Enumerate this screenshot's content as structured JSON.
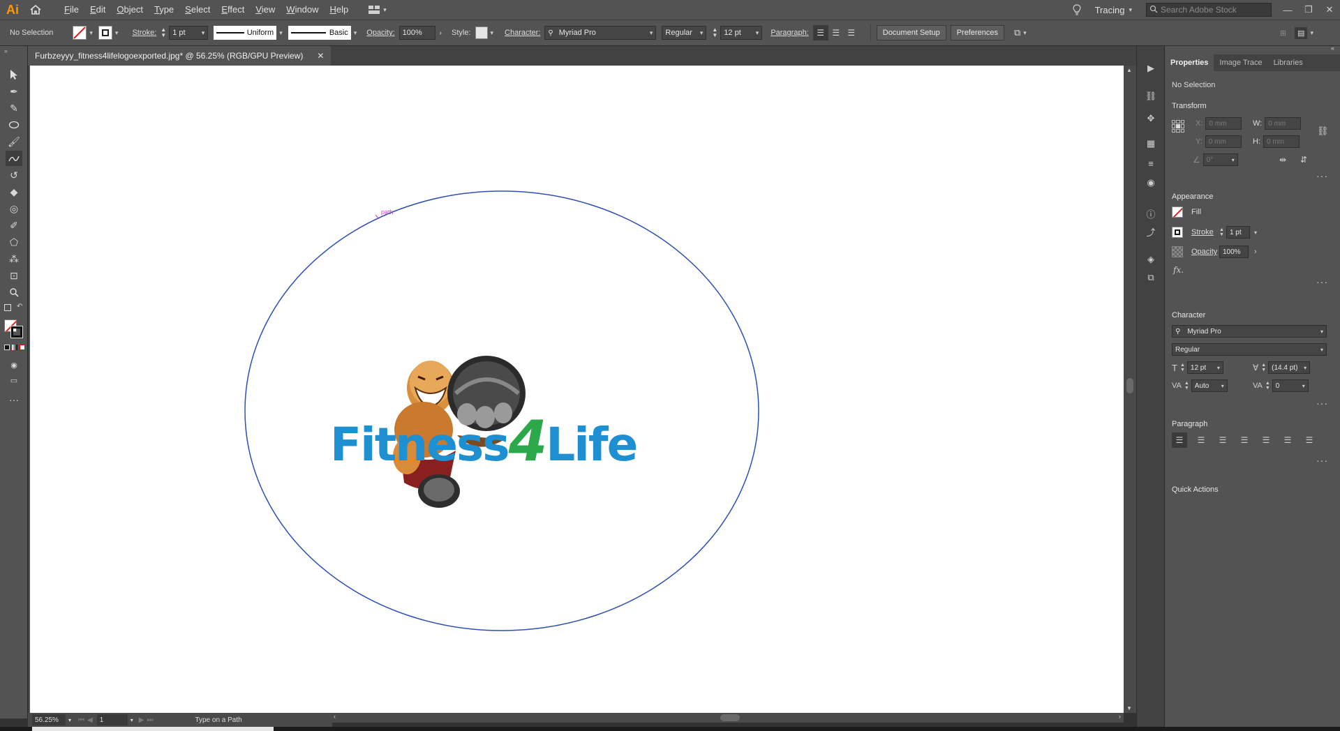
{
  "app": {
    "logo": "Ai"
  },
  "menu": [
    "File",
    "Edit",
    "Object",
    "Type",
    "Select",
    "Effect",
    "View",
    "Window",
    "Help"
  ],
  "workspace": {
    "name": "Tracing"
  },
  "stock_search": {
    "placeholder": "Search Adobe Stock"
  },
  "control_bar": {
    "selection": "No Selection",
    "stroke_label": "Stroke:",
    "stroke_value": "1 pt",
    "profile": "Uniform",
    "brush": "Basic",
    "opacity_label": "Opacity:",
    "opacity_value": "100%",
    "style_label": "Style:",
    "character_label": "Character:",
    "font": "Myriad Pro",
    "font_style": "Regular",
    "font_size": "12 pt",
    "paragraph_label": "Paragraph:",
    "document_setup": "Document Setup",
    "preferences": "Preferences"
  },
  "document": {
    "tab_title": "Furbzeyyy_fitness4lifelogoexported.jpg* @ 56.25% (RGB/GPU Preview)",
    "logo_text_a": "Fitness",
    "logo_text_b": "4",
    "logo_text_c": "Life",
    "path_hint": "path"
  },
  "status_bar": {
    "zoom": "56.25%",
    "page": "1",
    "tool": "Type on a Path"
  },
  "properties_panel": {
    "tabs": [
      "Properties",
      "Image Trace",
      "Libraries"
    ],
    "selection": "No Selection",
    "transform": {
      "title": "Transform",
      "x_label": "X:",
      "x_value": "0 mm",
      "y_label": "Y:",
      "y_value": "0 mm",
      "w_label": "W:",
      "w_value": "0 mm",
      "h_label": "H:",
      "h_value": "0 mm",
      "angle_value": "0°"
    },
    "appearance": {
      "title": "Appearance",
      "fill_label": "Fill",
      "stroke_label": "Stroke",
      "stroke_value": "1 pt",
      "opacity_label": "Opacity",
      "opacity_value": "100%",
      "fx": "fx."
    },
    "character": {
      "title": "Character",
      "font": "Myriad Pro",
      "style": "Regular",
      "size": "12 pt",
      "leading": "(14.4 pt)",
      "kerning": "Auto",
      "tracking": "0"
    },
    "paragraph": {
      "title": "Paragraph"
    },
    "quick_actions": {
      "title": "Quick Actions"
    }
  },
  "colors": {
    "logo_blue": "#1e8fd0",
    "logo_green": "#2aa84a",
    "path_blue": "#2c4fb5",
    "app_orange": "#ff9a00"
  }
}
